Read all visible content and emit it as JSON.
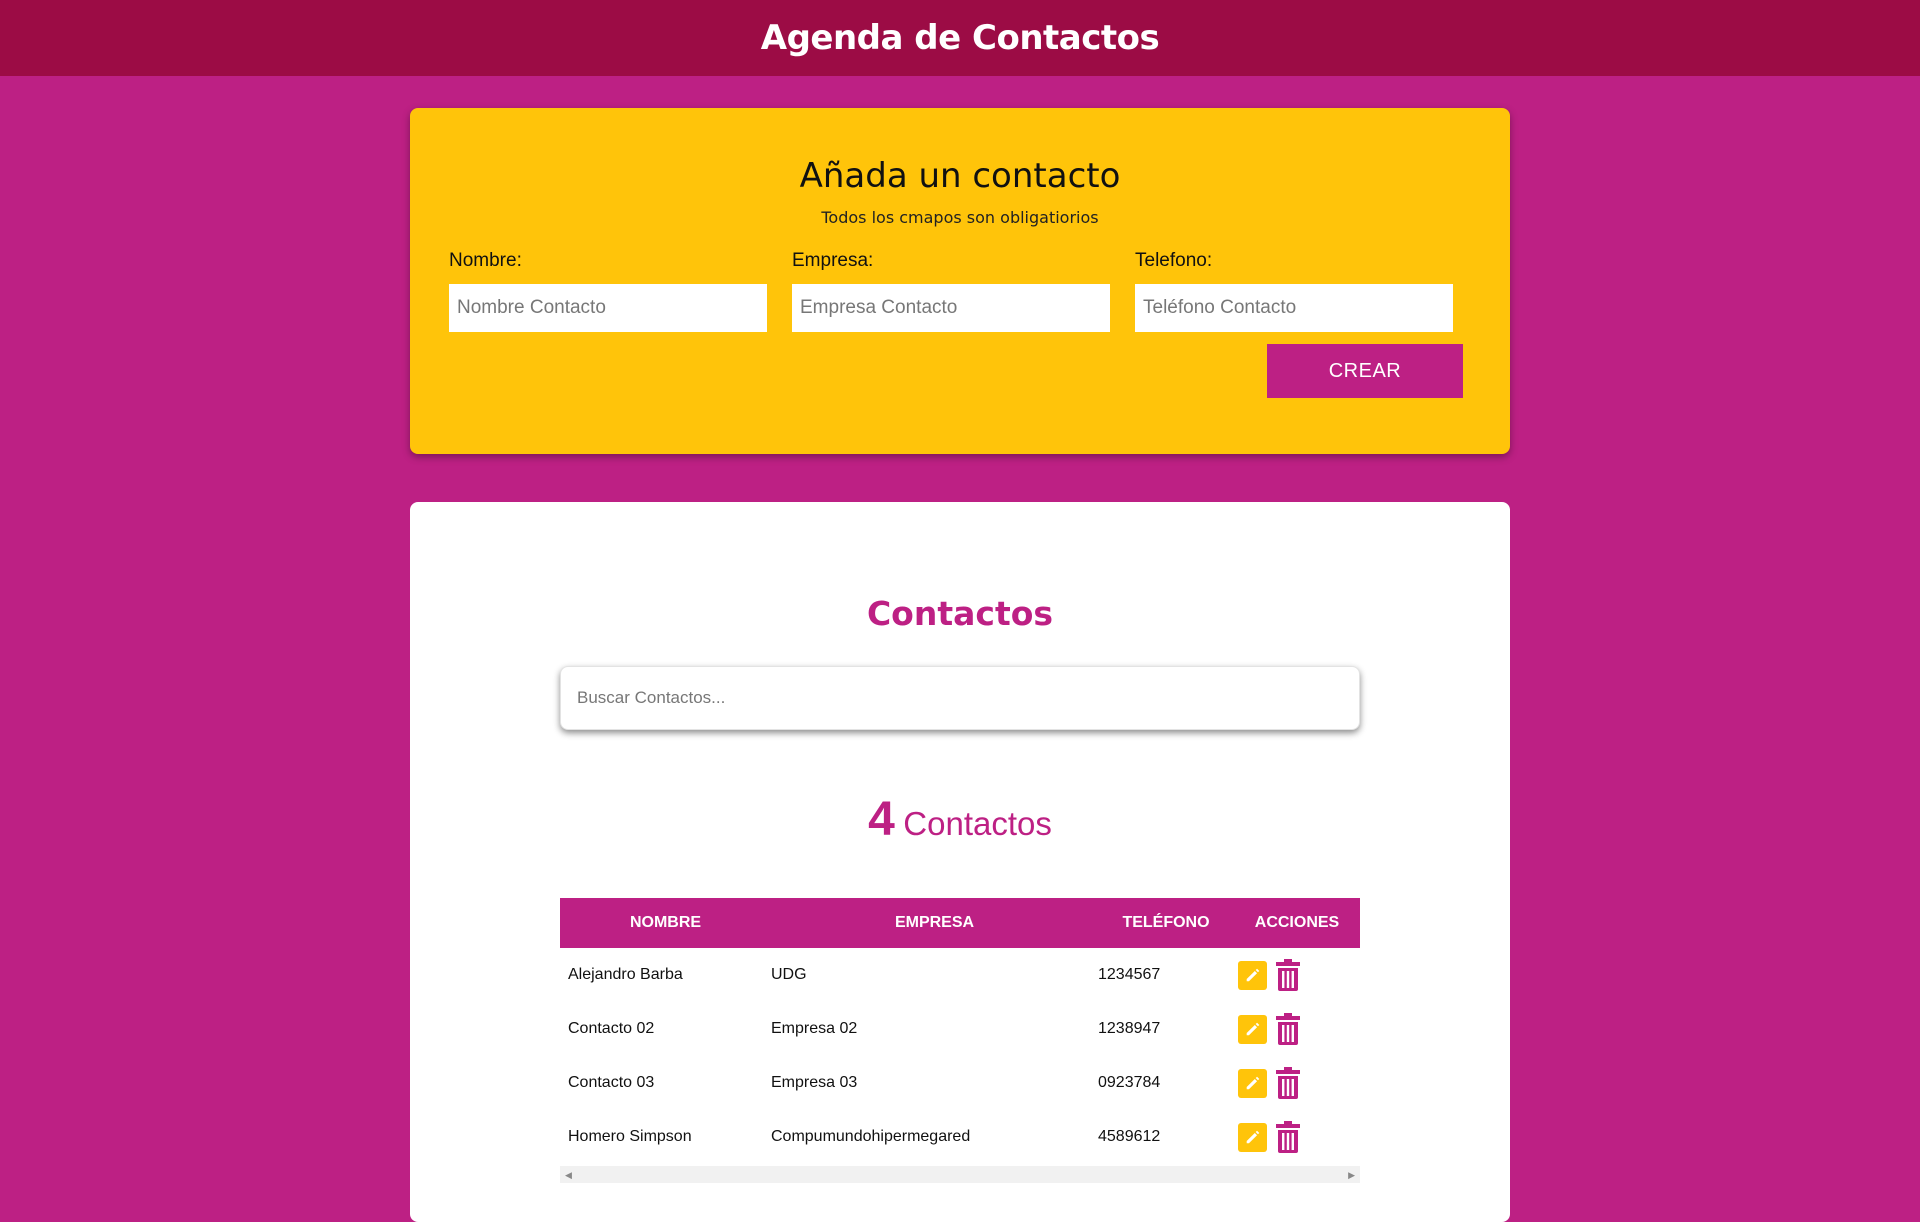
{
  "header": {
    "title": "Agenda de Contactos"
  },
  "form": {
    "title": "Añada un contacto",
    "subtitle": "Todos los cmapos son obligatiorios",
    "fields": [
      {
        "label": "Nombre:",
        "placeholder": "Nombre Contacto"
      },
      {
        "label": "Empresa:",
        "placeholder": "Empresa Contacto"
      },
      {
        "label": "Telefono:",
        "placeholder": "Teléfono Contacto"
      }
    ],
    "submit_label": "CREAR"
  },
  "list": {
    "title": "Contactos",
    "search_placeholder": "Buscar Contactos...",
    "count": "4",
    "count_label": "Contactos",
    "columns": [
      "NOMBRE",
      "EMPRESA",
      "TELÉFONO",
      "ACCIONES"
    ],
    "rows": [
      {
        "nombre": "Alejandro Barba",
        "empresa": "UDG",
        "telefono": "1234567"
      },
      {
        "nombre": "Contacto 02",
        "empresa": "Empresa 02",
        "telefono": "1238947"
      },
      {
        "nombre": "Contacto 03",
        "empresa": "Empresa 03",
        "telefono": "0923784"
      },
      {
        "nombre": "Homero Simpson",
        "empresa": "Compumundohipermegared",
        "telefono": "4589612"
      }
    ],
    "row_actions": {
      "edit_icon": "pencil-icon",
      "delete_icon": "trash-icon"
    }
  },
  "colors": {
    "background": "#bd2084",
    "header": "#9c0c45",
    "form_card": "#ffc40a",
    "accent": "#bd2084"
  }
}
